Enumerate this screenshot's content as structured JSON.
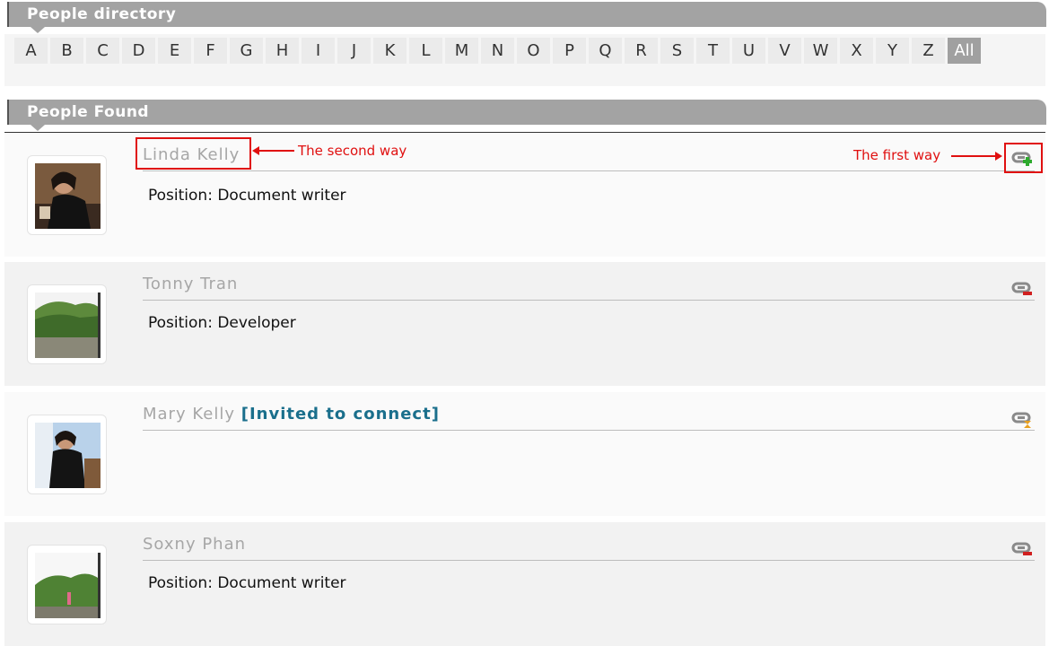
{
  "directory": {
    "title": "People directory",
    "letters": [
      "A",
      "B",
      "C",
      "D",
      "E",
      "F",
      "G",
      "H",
      "I",
      "J",
      "K",
      "L",
      "M",
      "N",
      "O",
      "P",
      "Q",
      "R",
      "S",
      "T",
      "U",
      "V",
      "W",
      "X",
      "Y",
      "Z",
      "All"
    ],
    "active_letter": "All"
  },
  "results": {
    "title": "People Found",
    "people": [
      {
        "name": "Linda Kelly",
        "position": "Position: Document writer",
        "connection_icon": "connect-add-icon",
        "status": ""
      },
      {
        "name": "Tonny Tran",
        "position": "Position: Developer",
        "connection_icon": "connect-remove-icon",
        "status": ""
      },
      {
        "name": "Mary Kelly",
        "position": "",
        "connection_icon": "connect-pending-icon",
        "status": "[Invited to connect]"
      },
      {
        "name": "Soxny Phan",
        "position": "Position: Document writer",
        "connection_icon": "connect-remove-icon",
        "status": ""
      }
    ]
  },
  "annotations": {
    "second_way": "The second way",
    "first_way": "The first way"
  },
  "colors": {
    "header_bg": "#a3a3a3",
    "annotation": "#e01010",
    "invite_status": "#1a6f8c"
  }
}
